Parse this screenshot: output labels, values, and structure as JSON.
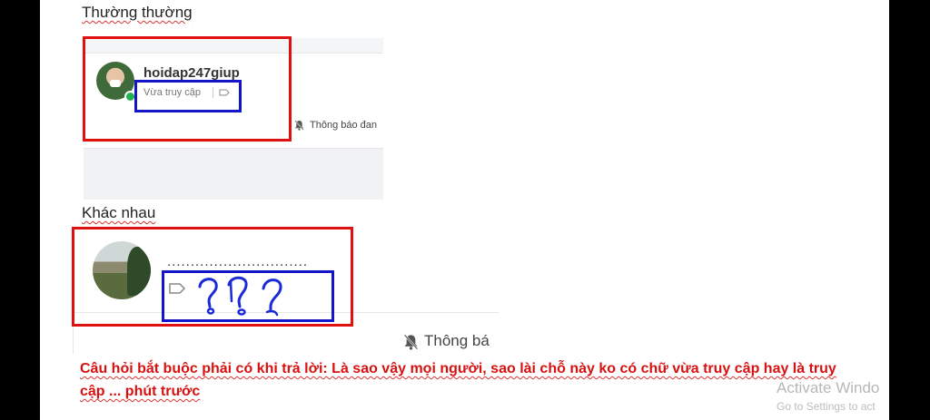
{
  "section1": {
    "heading": "Thường thường",
    "username": "hoidap247giup",
    "status": "Vừa truy cập",
    "notification": "Thông báo đan"
  },
  "section2": {
    "heading": "Khác nhau",
    "username": "..............................",
    "notification": "Thông bá"
  },
  "question": "Câu hỏi bắt buộc phải có khi trả lời:  Là sao vậy mọi người, sao lài chỗ này ko có chữ vừa truy cập hay là truy cập ... phút trước",
  "watermark": {
    "title": "Activate Windo",
    "subtitle": "Go to Settings to act"
  },
  "colors": {
    "red_annotation": "#e01010",
    "blue_annotation": "#1414c8",
    "online_dot": "#22b14c"
  },
  "icons": [
    "tag-icon",
    "bell-muted-icon",
    "question-mark-scribble"
  ]
}
